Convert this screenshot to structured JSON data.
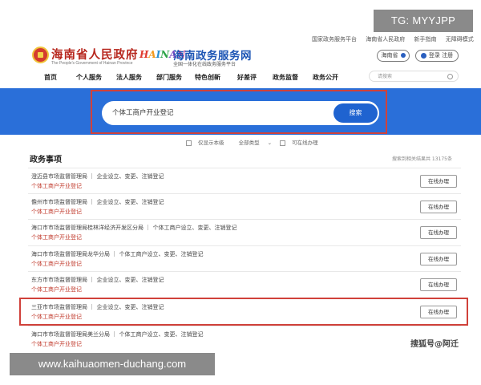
{
  "watermark_tg": "TG: MYYJPP",
  "watermark_url": "www.kaihuaomen-duchang.com",
  "watermark_source": "搜狐号@阿迁",
  "header": {
    "top_links": [
      "国家政务服务平台",
      "海南省人民政府",
      "新手指南",
      "无障碍模式"
    ],
    "gov_title": "海南省人民政府",
    "gov_subtitle": "The People's Government of Hainan Province",
    "logo_letters": [
      "H",
      "A",
      "I",
      "N",
      "A",
      "N"
    ],
    "service_title": "海南政务服务网",
    "service_subtitle": "全国一体化在线政务服务平台",
    "region": "海南省",
    "login": "登录 注册",
    "search_placeholder": "请搜索"
  },
  "nav": {
    "items": [
      "首页",
      "个人服务",
      "法人服务",
      "部门服务",
      "特色创新",
      "好差评",
      "政务监督",
      "政务公开"
    ]
  },
  "search": {
    "query": "个体工商户开业登记",
    "button": "搜索"
  },
  "filters": {
    "only_this_level": "仅显示本级",
    "all_types": "全部类型",
    "online": "可在线办理"
  },
  "section": {
    "title": "政务事项",
    "count": "搜索到相关结果共 13175条"
  },
  "results": [
    {
      "dept": "澄迈县市场监督管理局 ｜ 企业设立、变更、注销登记",
      "name": "个体工商户开业登记",
      "action": "在线办理"
    },
    {
      "dept": "儋州市市场监督管理局 ｜ 企业设立、变更、注销登记",
      "name": "个体工商户开业登记",
      "action": "在线办理"
    },
    {
      "dept": "海口市市场监督管理局桂林洋经济开发区分局 ｜ 个体工商户设立、变更、注销登记",
      "name": "个体工商户开业登记",
      "action": "在线办理"
    },
    {
      "dept": "海口市市场监督管理局龙华分局 ｜ 个体工商户设立、变更、注销登记",
      "name": "个体工商户开业登记",
      "action": "在线办理"
    },
    {
      "dept": "东方市市场监督管理局 ｜ 企业设立、变更、注销登记",
      "name": "个体工商户开业登记",
      "action": "在线办理"
    },
    {
      "dept": "三亚市市场监督管理局 ｜ 企业设立、变更、注销登记",
      "name": "个体工商户开业登记",
      "action": "在线办理"
    },
    {
      "dept": "海口市市场监督管理局美兰分局 ｜ 个体工商户设立、变更、注销登记",
      "name": "个体工商户开业登记",
      "action": ""
    }
  ],
  "colors": {
    "band_blue": "#2a6fd9",
    "button_blue": "#1f63d0",
    "highlight_red": "#d0413a",
    "link_red": "#c0392b"
  }
}
